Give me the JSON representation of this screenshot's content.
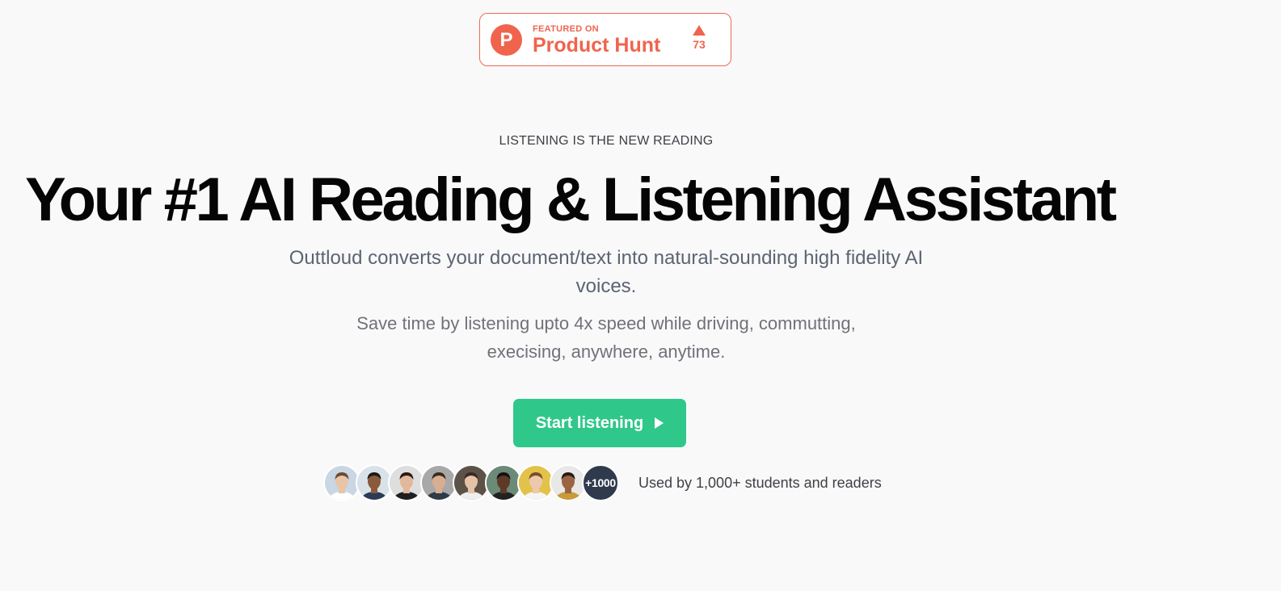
{
  "product_hunt": {
    "featured_label": "FEATURED ON",
    "name": "Product Hunt",
    "logo_letter": "P",
    "votes": "73",
    "accent_color": "#f0644e"
  },
  "hero": {
    "eyebrow": "LISTENING IS THE NEW READING",
    "headline": "Your #1 AI Reading & Listening Assistant",
    "subtitle": "Outtloud converts your document/text into natural-sounding high fidelity AI voices.",
    "description": "Save time by listening upto 4x speed while driving, commutting, execising, anywhere, anytime."
  },
  "cta": {
    "label": "Start listening",
    "icon": "play-icon",
    "color": "#30c78b"
  },
  "social_proof": {
    "avatars": [
      {
        "name": "avatar-1",
        "skin": "#e8c4a8",
        "hair": "#6b4a32",
        "bg": "#c9d6e3",
        "shirt": "#ffffff"
      },
      {
        "name": "avatar-2",
        "skin": "#8a5a3c",
        "hair": "#1d1a18",
        "bg": "#d8e2e8",
        "shirt": "#2b3a55"
      },
      {
        "name": "avatar-3",
        "skin": "#e2b89a",
        "hair": "#2a1c14",
        "bg": "#dedede",
        "shirt": "#1f1f1f"
      },
      {
        "name": "avatar-4",
        "skin": "#d9ae90",
        "hair": "#3b2b22",
        "bg": "#a8a8a8",
        "shirt": "#303a48"
      },
      {
        "name": "avatar-5",
        "skin": "#e6c2a6",
        "hair": "#3a2a20",
        "bg": "#5d5248",
        "shirt": "#eeeeee"
      },
      {
        "name": "avatar-6",
        "skin": "#5c3a26",
        "hair": "#151110",
        "bg": "#6b8a78",
        "shirt": "#222222"
      },
      {
        "name": "avatar-7",
        "skin": "#ecc9ac",
        "hair": "#7a4e2a",
        "bg": "#e3c24a",
        "shirt": "#f5f5f5"
      },
      {
        "name": "avatar-8",
        "skin": "#9a6444",
        "hair": "#2a1a12",
        "bg": "#e8e8e8",
        "shirt": "#c99a3a"
      }
    ],
    "more_label": "+1000",
    "text": "Used by 1,000+ students and readers"
  }
}
